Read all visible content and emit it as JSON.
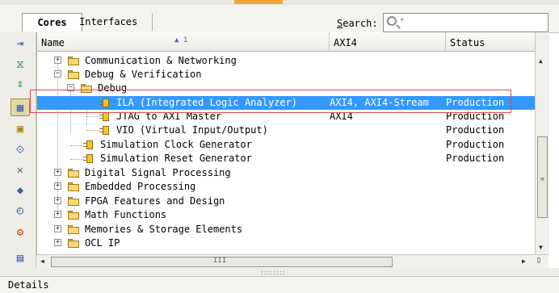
{
  "tabs": [
    {
      "label": "Cores",
      "active": true
    },
    {
      "label": "Interfaces",
      "active": false
    }
  ],
  "search": {
    "label": "Search:",
    "value": "",
    "icon": "search-icon"
  },
  "toolbar_icons": [
    "collapse-all-icon",
    "expand-icon",
    "refresh-icon",
    "hierarchy-icon",
    "ip-settings-icon",
    "interface-icon",
    "wrench-icon",
    "cube-icon",
    "clock-icon",
    "gear-icon",
    "document-icon"
  ],
  "columns": {
    "name": "Name",
    "sort_indicator": "1",
    "axi": "AXI4",
    "status": "Status"
  },
  "rows": [
    {
      "name": "Communication & Networking",
      "type": "category",
      "axi": "",
      "status": ""
    },
    {
      "name": "Debug & Verification",
      "type": "category",
      "axi": "",
      "status": ""
    },
    {
      "name": "Debug",
      "type": "category",
      "axi": "",
      "status": ""
    },
    {
      "name": "ILA (Integrated Logic Analyzer)",
      "type": "ip",
      "axi": "AXI4, AXI4-Stream",
      "status": "Production",
      "selected": true
    },
    {
      "name": "JTAG to AXI Master",
      "type": "ip",
      "axi": "AXI4",
      "status": "Production"
    },
    {
      "name": "VIO (Virtual Input/Output)",
      "type": "ip",
      "axi": "",
      "status": "Production"
    },
    {
      "name": "Simulation Clock Generator",
      "type": "ip",
      "axi": "",
      "status": "Production"
    },
    {
      "name": "Simulation Reset Generator",
      "type": "ip",
      "axi": "",
      "status": "Production"
    },
    {
      "name": "Digital Signal Processing",
      "type": "category",
      "axi": "",
      "status": ""
    },
    {
      "name": "Embedded Processing",
      "type": "category",
      "axi": "",
      "status": ""
    },
    {
      "name": "FPGA Features and Design",
      "type": "category",
      "axi": "",
      "status": ""
    },
    {
      "name": "Math Functions",
      "type": "category",
      "axi": "",
      "status": ""
    },
    {
      "name": "Memories & Storage Elements",
      "type": "category",
      "axi": "",
      "status": ""
    },
    {
      "name": "OCL IP",
      "type": "category",
      "axi": "",
      "status": ""
    }
  ],
  "details_label": "Details",
  "colors": {
    "selection": "#3399ff",
    "highlight_box": "#e04b4b",
    "folder": "#f6d77a"
  }
}
